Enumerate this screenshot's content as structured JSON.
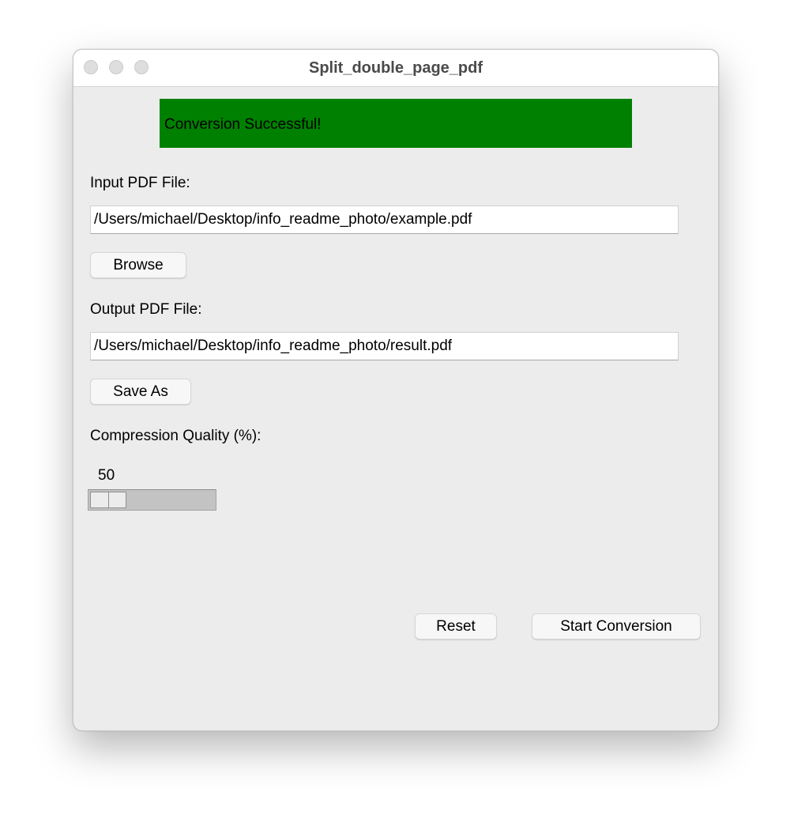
{
  "window": {
    "title": "Split_double_page_pdf"
  },
  "status": {
    "message": "Conversion Successful!",
    "color": "#008000"
  },
  "input": {
    "label": "Input PDF File:",
    "value": "/Users/michael/Desktop/info_readme_photo/example.pdf",
    "browse_label": "Browse"
  },
  "output": {
    "label": "Output PDF File:",
    "value": "/Users/michael/Desktop/info_readme_photo/result.pdf",
    "save_as_label": "Save As"
  },
  "compression": {
    "label": "Compression Quality (%):",
    "value": "50"
  },
  "actions": {
    "reset_label": "Reset",
    "start_label": "Start Conversion"
  }
}
